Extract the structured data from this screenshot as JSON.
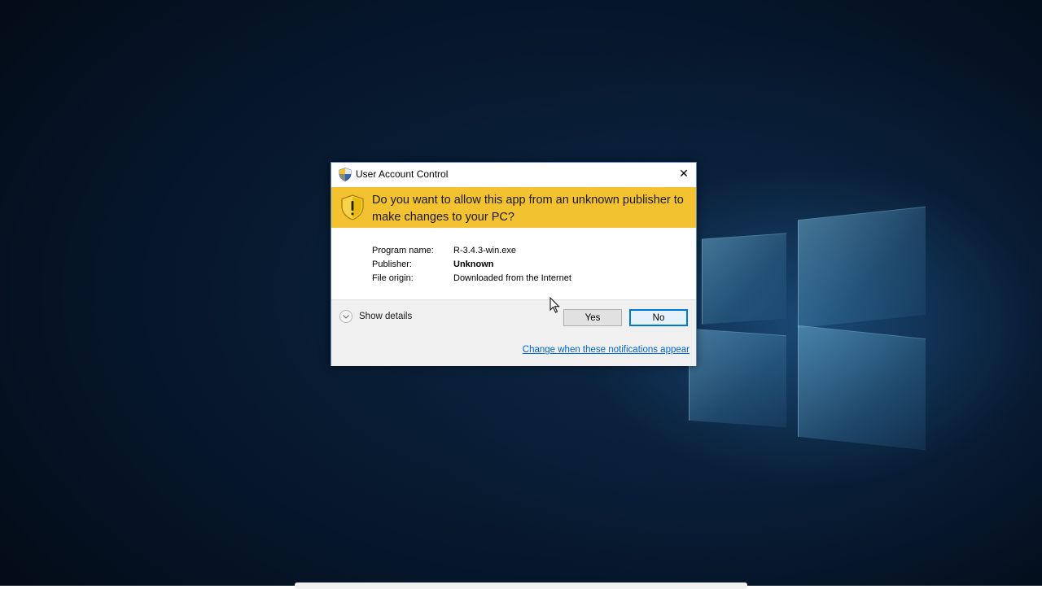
{
  "dialog": {
    "title": "User Account Control",
    "close_symbol": "✕",
    "question": "Do you want to allow this app from an unknown publisher to make changes to your PC?",
    "info": [
      {
        "label": "Program name:",
        "value": "R-3.4.3-win.exe",
        "bold": false
      },
      {
        "label": "Publisher:",
        "value": "Unknown",
        "bold": true
      },
      {
        "label": "File origin:",
        "value": "Downloaded from the Internet",
        "bold": false
      }
    ],
    "show_details_label": "Show details",
    "yes_label": "Yes",
    "no_label": "No",
    "change_link": "Change when these notifications appear"
  },
  "icons": {
    "title_icon": "uac-shield-icon",
    "banner_icon": "warning-shield-icon",
    "details_icon": "chevron-down-icon",
    "close_icon": "close-icon"
  },
  "colors": {
    "banner": "#f2c230",
    "accent": "#0078d7",
    "link": "#0066cc"
  }
}
